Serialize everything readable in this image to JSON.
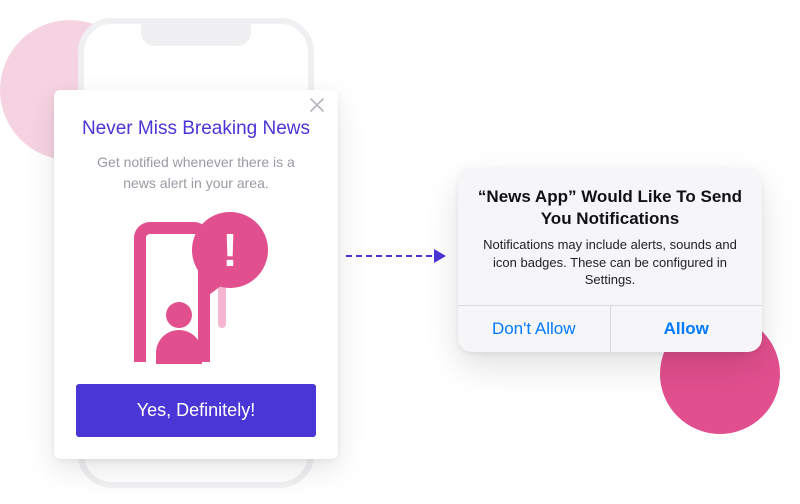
{
  "pre_prompt": {
    "title": "Never Miss Breaking News",
    "subtitle": "Get notified whenever there is a news alert in your area.",
    "cta_label": "Yes, Definitely!",
    "illustration_glyph": "!"
  },
  "ios_alert": {
    "title": "“News App” Would Like To Send You Notifications",
    "message": "Notifications may include alerts, sounds and icon badges. These can be configured in Settings.",
    "deny_label": "Don't Allow",
    "allow_label": "Allow"
  }
}
